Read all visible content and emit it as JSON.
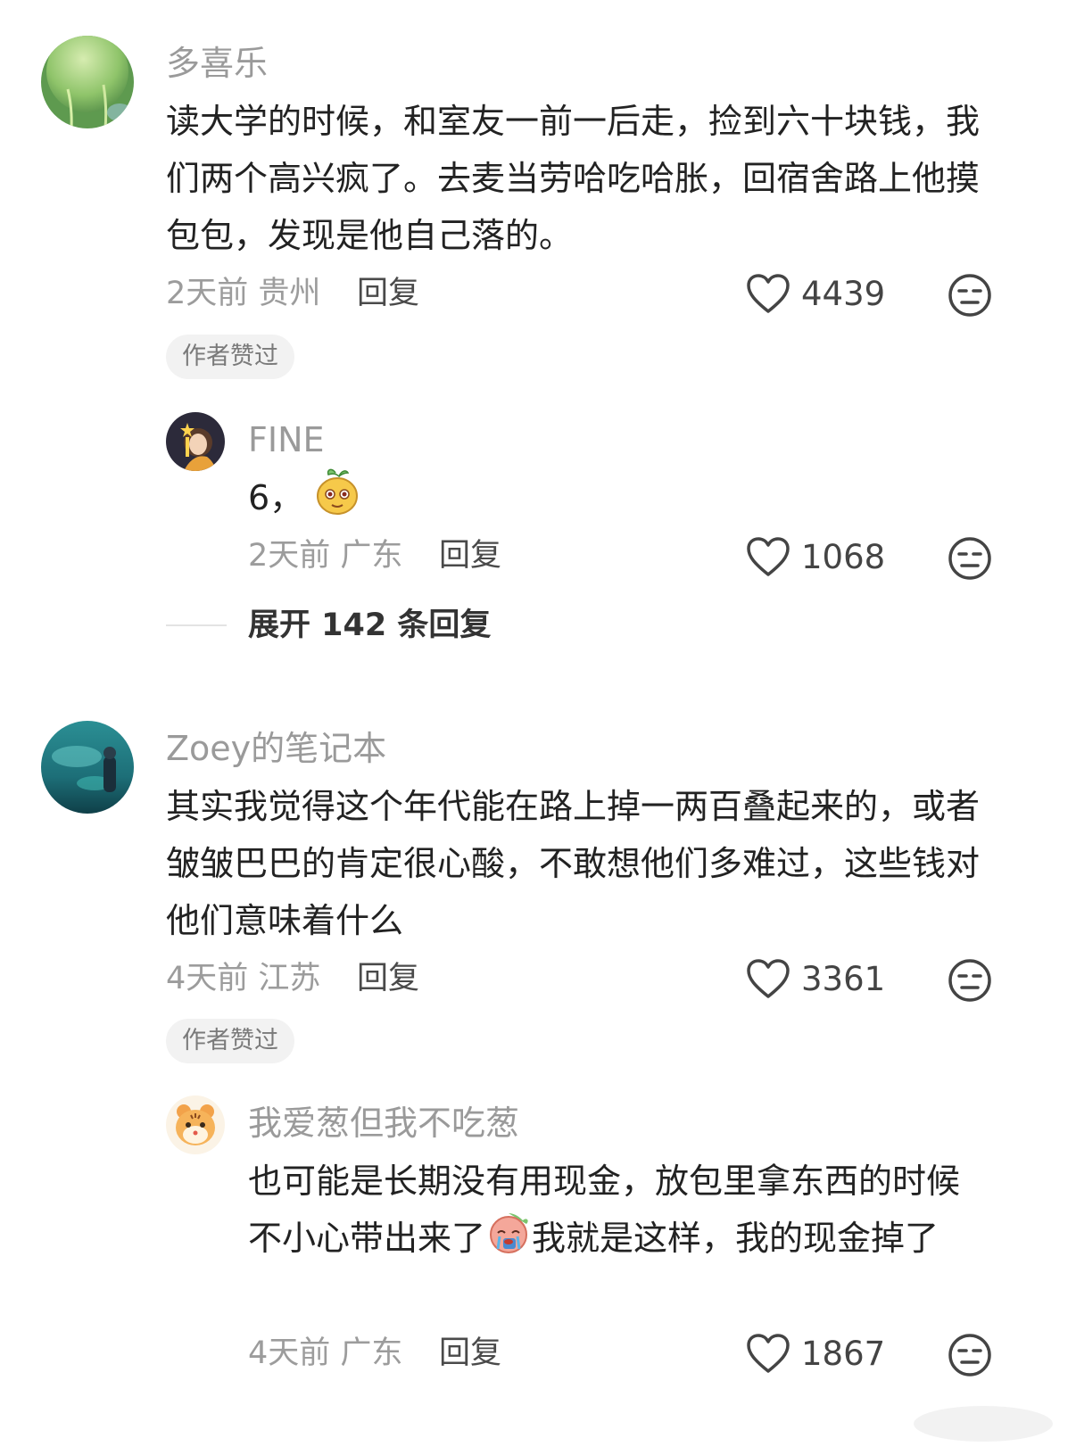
{
  "comments": [
    {
      "author": "多喜乐",
      "text": "读大学的时候，和室友一前一后走，捡到六十块钱，我们两个高兴疯了。去麦当劳哈吃哈胀，回宿舍路上他摸包包，发现是他自己落的。",
      "time_location": "2天前 贵州",
      "reply_label": "回复",
      "likes": "4439",
      "badge": "作者赞过",
      "sub_reply": {
        "author": "FINE",
        "text": "6，",
        "time_location": "2天前 广东",
        "reply_label": "回复",
        "likes": "1068"
      },
      "expand_label": "展开 142 条回复"
    },
    {
      "author": "Zoey的笔记本",
      "text": "其实我觉得这个年代能在路上掉一两百叠起来的，或者皱皱巴巴的肯定很心酸，不敢想他们多难过，这些钱对他们意味着什么",
      "time_location": "4天前 江苏",
      "reply_label": "回复",
      "likes": "3361",
      "badge": "作者赞过",
      "sub_reply": {
        "author": "我爱葱但我不吃葱",
        "text_before_emoji": "也可能是长期没有用现金，放包里拿东西的时候不小心带出来了",
        "text_after_emoji": "我就是这样，我的现金掉了",
        "time_location": "4天前 广东",
        "reply_label": "回复",
        "likes": "1867"
      }
    }
  ],
  "icons": {
    "like": "heart-outline-icon",
    "dislike": "unamused-face-icon"
  }
}
